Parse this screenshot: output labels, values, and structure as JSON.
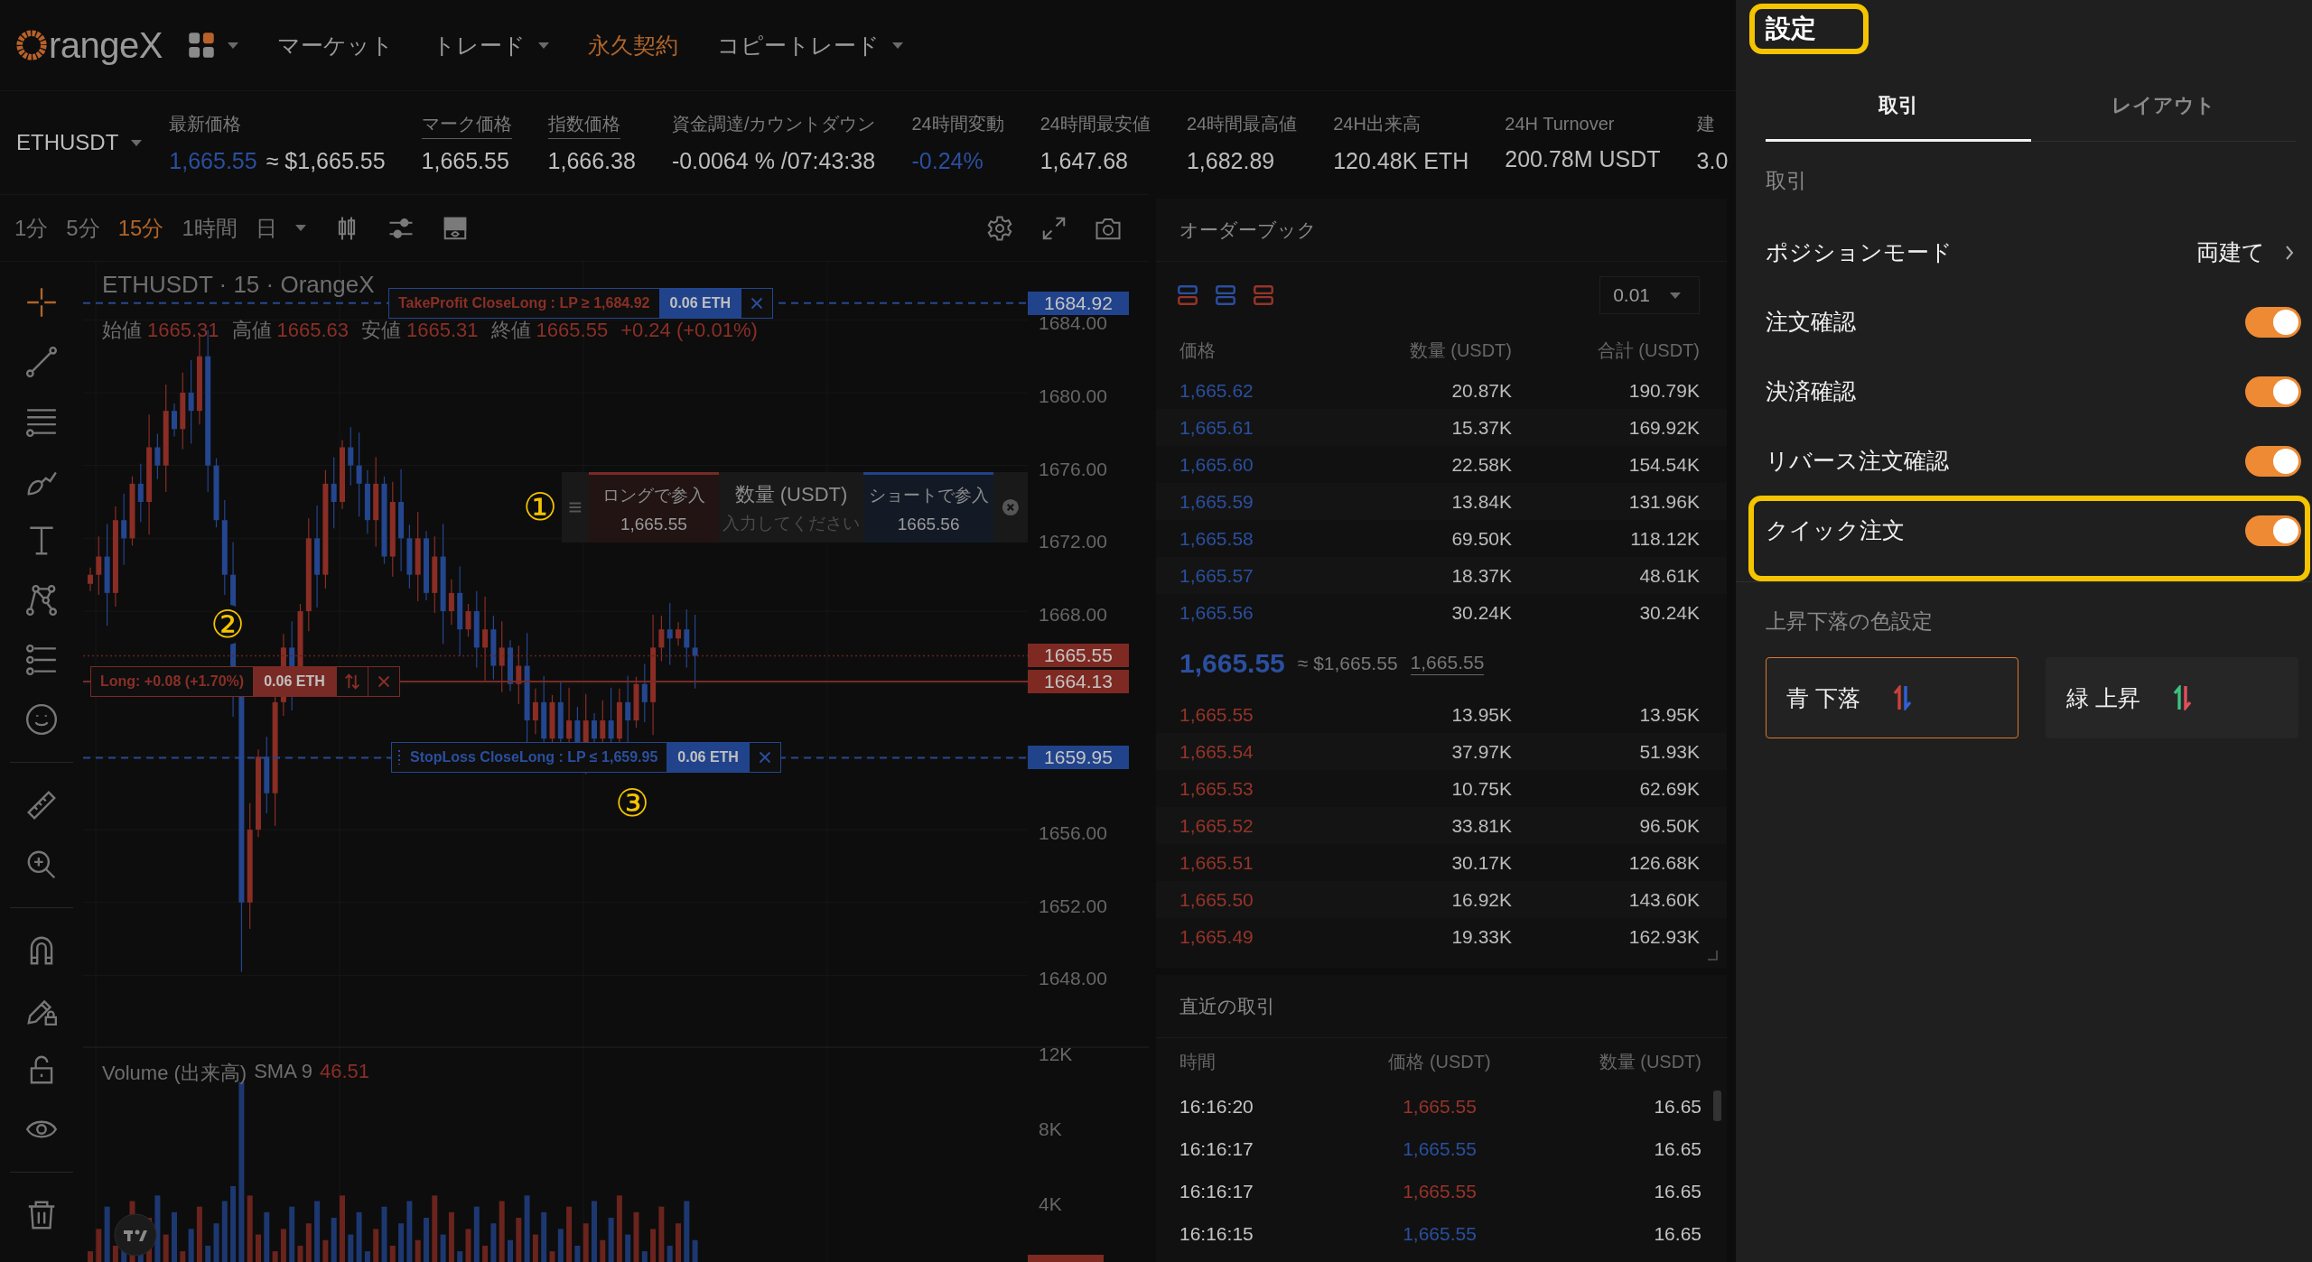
{
  "nav": {
    "logo": "rangeX",
    "items": [
      {
        "label": "マーケット",
        "selected": false,
        "dropdown": false
      },
      {
        "label": "トレード",
        "selected": false,
        "dropdown": true
      },
      {
        "label": "永久契約",
        "selected": true,
        "dropdown": false
      },
      {
        "label": "コピートレード",
        "selected": false,
        "dropdown": true
      }
    ]
  },
  "ticker": {
    "symbol": "ETHUSDT",
    "stats": [
      {
        "label": "最新価格",
        "value": "1,665.55",
        "note": "≈ $1,665.55",
        "falling": true,
        "underlined": false
      },
      {
        "label": "マーク価格",
        "value": "1,665.55",
        "falling": false,
        "underlined": true
      },
      {
        "label": "指数価格",
        "value": "1,666.38",
        "falling": false,
        "underlined": true
      },
      {
        "label": "資金調達/カウントダウン",
        "value": "-0.0064 % /07:43:38",
        "falling": false,
        "underlined": false
      },
      {
        "label": "24時間変動",
        "value": "-0.24%",
        "falling": true,
        "underlined": false
      },
      {
        "label": "24時間最安値",
        "value": "1,647.68",
        "falling": false,
        "underlined": false
      },
      {
        "label": "24時間最高値",
        "value": "1,682.89",
        "falling": false,
        "underlined": false
      },
      {
        "label": "24H出来高",
        "value": "120.48K ETH",
        "falling": false,
        "underlined": false
      },
      {
        "label": "24H Turnover",
        "value": "200.78M USDT",
        "falling": false,
        "underlined": false
      },
      {
        "label": "建",
        "value": "3.0",
        "falling": false,
        "underlined": false
      }
    ]
  },
  "chart": {
    "intervals": [
      {
        "label": "1分",
        "selected": false
      },
      {
        "label": "5分",
        "selected": false
      },
      {
        "label": "15分",
        "selected": true
      },
      {
        "label": "1時間",
        "selected": false
      },
      {
        "label": "日",
        "selected": false
      }
    ],
    "title": "ETHUSDT · 15 · OrangeX",
    "ohlc": [
      {
        "label": "始値",
        "value": "1665.31"
      },
      {
        "label": "高値",
        "value": "1665.63"
      },
      {
        "label": "安値",
        "value": "1665.31"
      },
      {
        "label": "終値",
        "value": "1665.55"
      }
    ],
    "change": "+0.24 (+0.01%)",
    "price_axis": [
      "1684.00",
      "1680.00",
      "1676.00",
      "1672.00",
      "1668.00",
      "1656.00",
      "1652.00",
      "1648.00"
    ],
    "last_price": "1665.55",
    "order_lines": [
      {
        "kind": "take_profit",
        "label": "TakeProfit CloseLong : LP ≥ 1,684.92",
        "size": "0.06 ETH",
        "price": "1684.92"
      },
      {
        "kind": "position",
        "label": "Long: +0.08 (+1.70%)",
        "size": "0.06 ETH",
        "price": "1664.13",
        "marker": "②"
      },
      {
        "kind": "stop_loss",
        "label": "StopLoss CloseLong : LP ≤ 1,659.95",
        "size": "0.06 ETH",
        "price": "1659.95",
        "marker": "③"
      }
    ],
    "quick_order": {
      "marker": "①",
      "long_label": "ロングで参入",
      "long_price": "1,665.55",
      "qty_label": "数量 (USDT)",
      "qty_placeholder": "入力してください",
      "short_label": "ショートで参入",
      "short_price": "1665.56"
    },
    "volume": {
      "label": "Volume (出来高)",
      "indicator": "SMA 9",
      "value": "46.51",
      "axis": [
        "12K",
        "8K",
        "4K"
      ]
    }
  },
  "order_book": {
    "title": "オーダーブック",
    "precision": "0.01",
    "columns": [
      "価格",
      "数量 (USDT)",
      "合計 (USDT)"
    ],
    "asks": [
      {
        "price": "1,665.62",
        "qty": "20.87K",
        "total": "190.79K"
      },
      {
        "price": "1,665.61",
        "qty": "15.37K",
        "total": "169.92K"
      },
      {
        "price": "1,665.60",
        "qty": "22.58K",
        "total": "154.54K"
      },
      {
        "price": "1,665.59",
        "qty": "13.84K",
        "total": "131.96K"
      },
      {
        "price": "1,665.58",
        "qty": "69.50K",
        "total": "118.12K"
      },
      {
        "price": "1,665.57",
        "qty": "18.37K",
        "total": "48.61K"
      },
      {
        "price": "1,665.56",
        "qty": "30.24K",
        "total": "30.24K"
      }
    ],
    "last": {
      "price": "1,665.55",
      "usd": "≈ $1,665.55",
      "mark": "1,665.55"
    },
    "bids": [
      {
        "price": "1,665.55",
        "qty": "13.95K",
        "total": "13.95K"
      },
      {
        "price": "1,665.54",
        "qty": "37.97K",
        "total": "51.93K"
      },
      {
        "price": "1,665.53",
        "qty": "10.75K",
        "total": "62.69K"
      },
      {
        "price": "1,665.52",
        "qty": "33.81K",
        "total": "96.50K"
      },
      {
        "price": "1,665.51",
        "qty": "30.17K",
        "total": "126.68K"
      },
      {
        "price": "1,665.50",
        "qty": "16.92K",
        "total": "143.60K"
      },
      {
        "price": "1,665.49",
        "qty": "19.33K",
        "total": "162.93K"
      }
    ]
  },
  "trades": {
    "title": "直近の取引",
    "columns": [
      "時間",
      "価格 (USDT)",
      "数量 (USDT)"
    ],
    "rows": [
      {
        "time": "16:16:20",
        "price": "1,665.55",
        "qty": "16.65",
        "buy": true
      },
      {
        "time": "16:16:17",
        "price": "1,665.55",
        "qty": "16.65",
        "buy": false
      },
      {
        "time": "16:16:17",
        "price": "1,665.55",
        "qty": "16.65",
        "buy": true
      },
      {
        "time": "16:16:15",
        "price": "1,665.55",
        "qty": "16.65",
        "buy": false
      }
    ]
  },
  "settings": {
    "title": "設定",
    "title_highlighted": true,
    "tabs": [
      {
        "label": "取引",
        "selected": true
      },
      {
        "label": "レイアウト",
        "selected": false
      }
    ],
    "section": "取引",
    "rows": [
      {
        "kind": "select",
        "label": "ポジションモード",
        "value": "両建て",
        "highlighted": false
      },
      {
        "kind": "toggle",
        "label": "注文確認",
        "on": true,
        "highlighted": false
      },
      {
        "kind": "toggle",
        "label": "決済確認",
        "on": true,
        "highlighted": false
      },
      {
        "kind": "toggle",
        "label": "リバース注文確認",
        "on": true,
        "highlighted": false
      },
      {
        "kind": "toggle",
        "label": "クイック注文",
        "on": true,
        "highlighted": true
      }
    ],
    "color_section": "上昇下落の色設定",
    "color_options": [
      {
        "label": "青 下落",
        "selected": true,
        "arrows": [
          {
            "color": "#c8413a"
          },
          {
            "color": "#2f62d6"
          }
        ]
      },
      {
        "label": "緑 上昇",
        "selected": false,
        "arrows": [
          {
            "color": "#3fbf7f"
          },
          {
            "color": "#e0505a"
          }
        ]
      }
    ]
  }
}
